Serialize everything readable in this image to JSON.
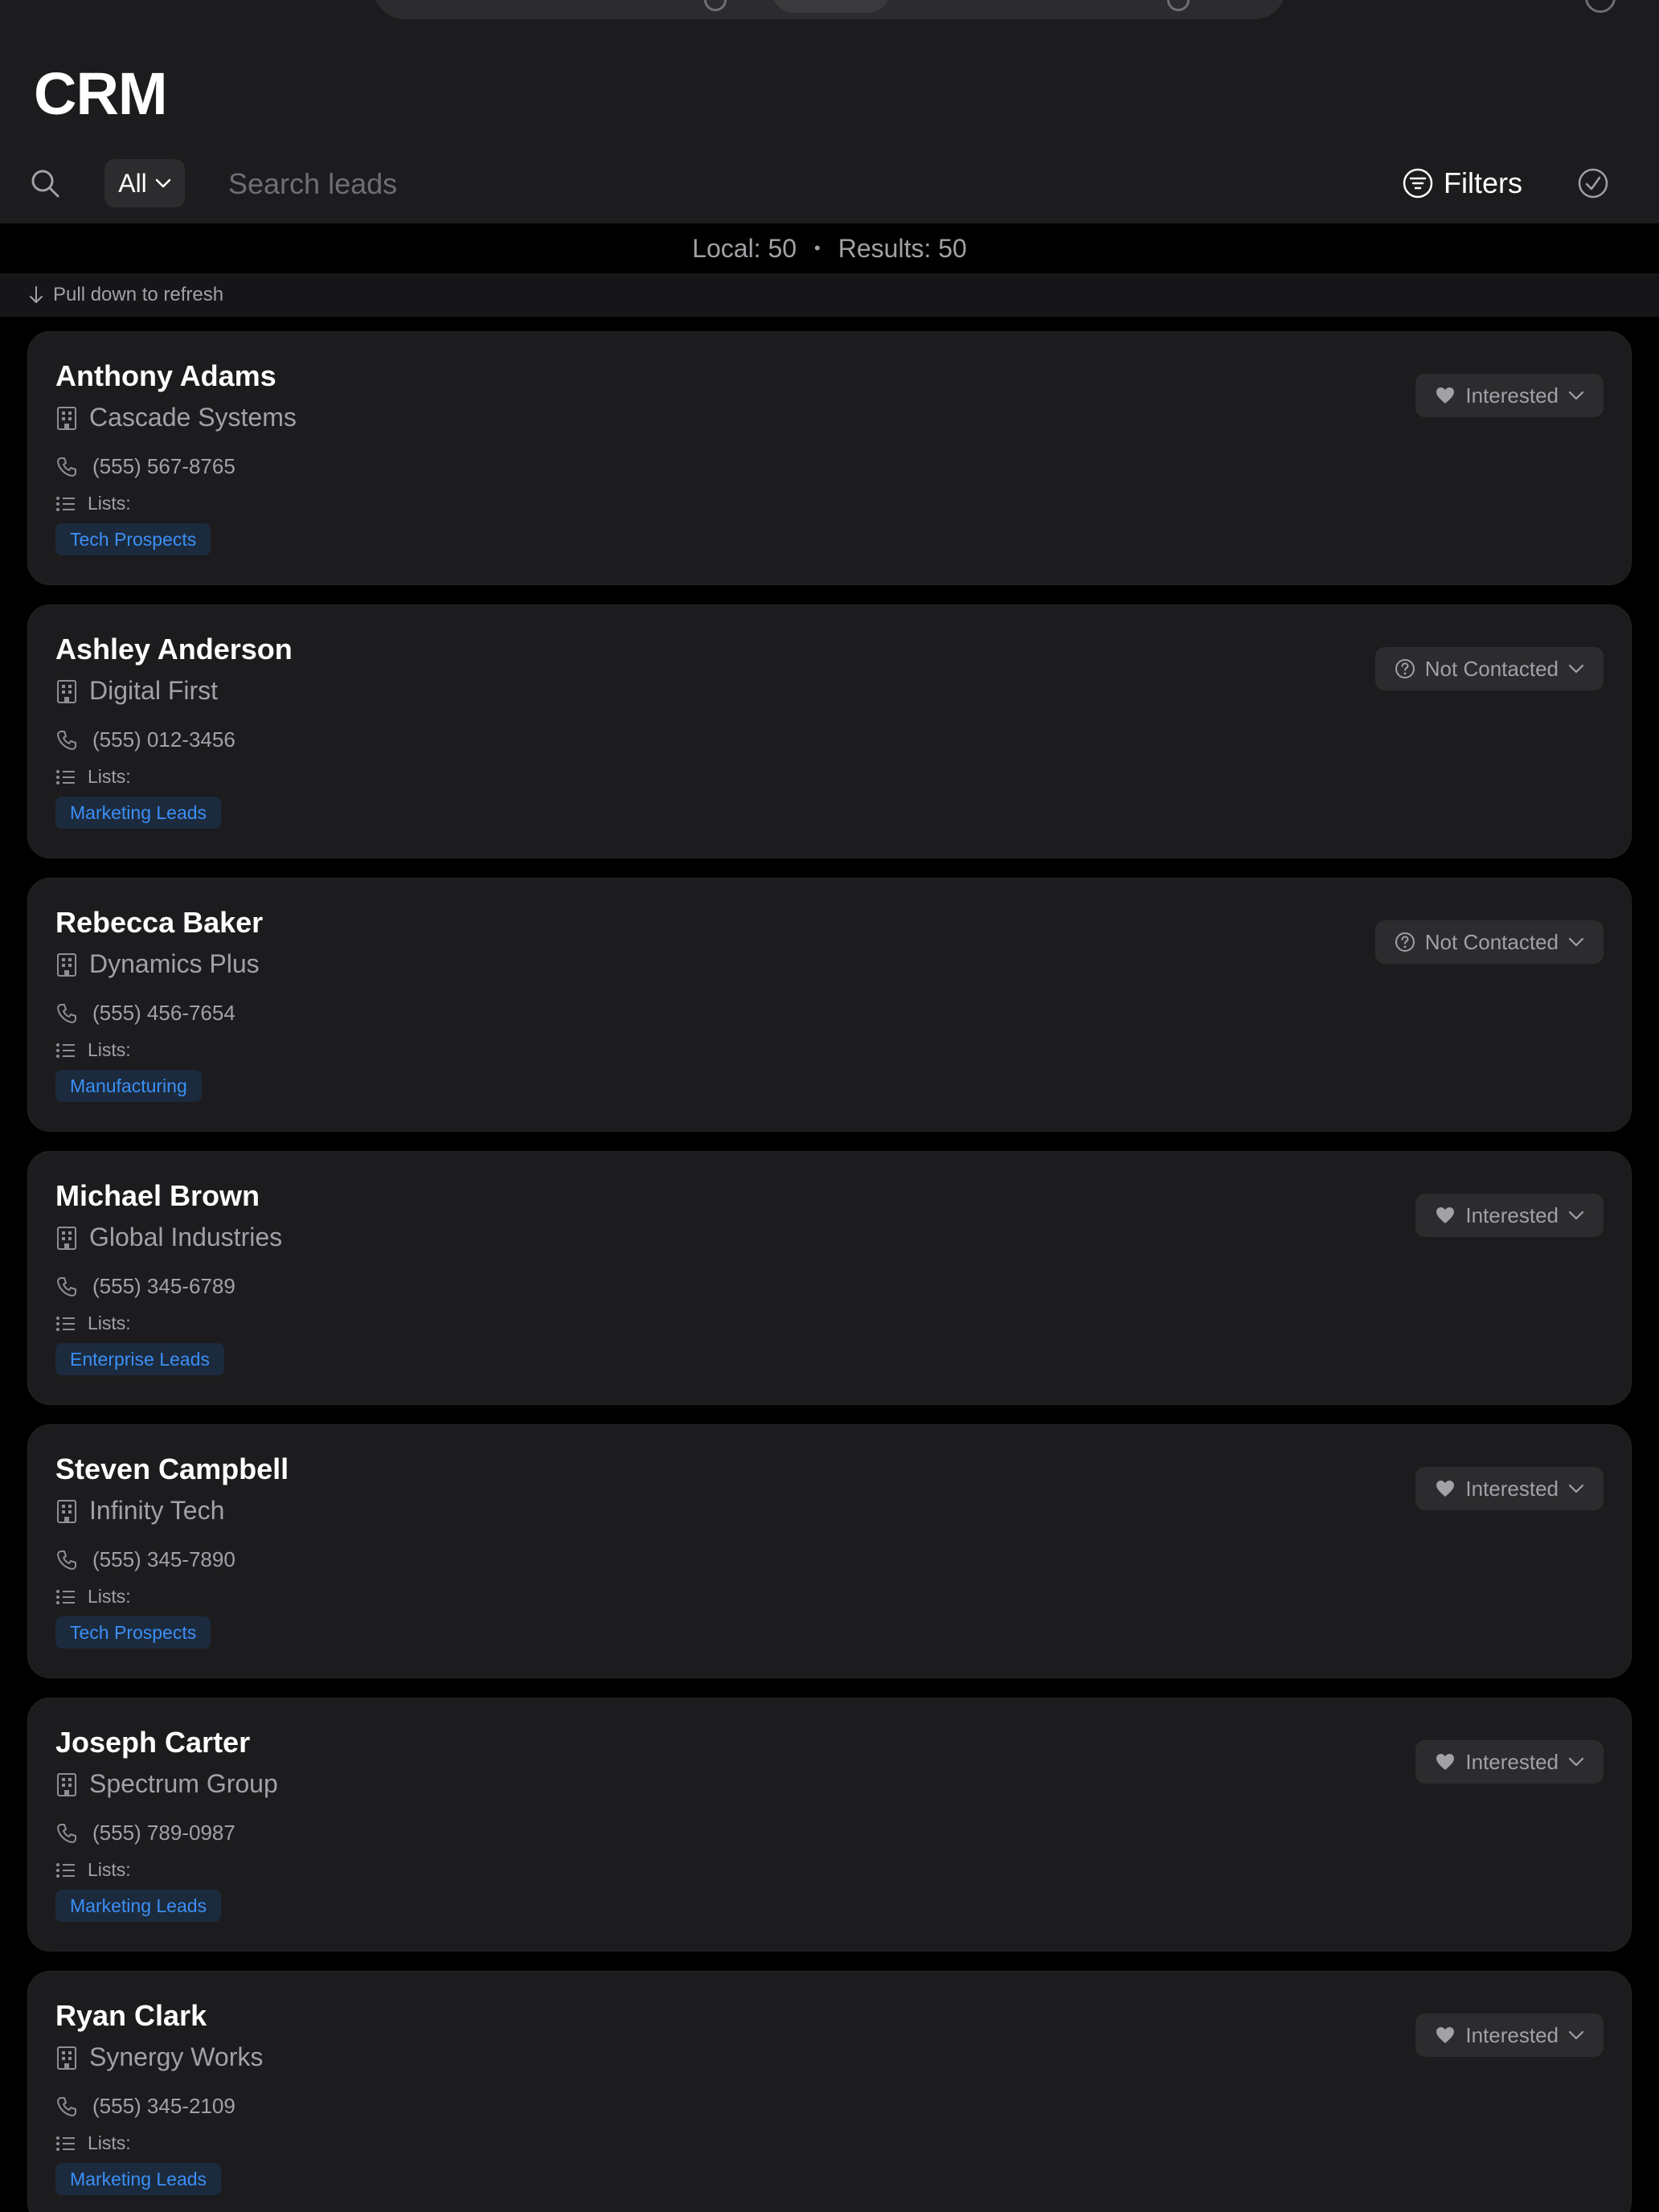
{
  "app": {
    "title": "CRM"
  },
  "search": {
    "scope": "All",
    "placeholder": "Search leads",
    "filters_label": "Filters"
  },
  "stats": {
    "local": "Local: 50",
    "separator": "•",
    "results": "Results: 50"
  },
  "refresh_hint": "Pull down to refresh",
  "lists_label": "Lists:",
  "leads": [
    {
      "name": "Anthony Adams",
      "company": "Cascade Systems",
      "phone": "(555) 567-8765",
      "list": "Tech Prospects",
      "status": "Interested",
      "status_icon": "heart-icon"
    },
    {
      "name": "Ashley Anderson",
      "company": "Digital First",
      "phone": "(555) 012-3456",
      "list": "Marketing Leads",
      "status": "Not Contacted",
      "status_icon": "question-circle-icon"
    },
    {
      "name": "Rebecca Baker",
      "company": "Dynamics Plus",
      "phone": "(555) 456-7654",
      "list": "Manufacturing",
      "status": "Not Contacted",
      "status_icon": "question-circle-icon"
    },
    {
      "name": "Michael Brown",
      "company": "Global Industries",
      "phone": "(555) 345-6789",
      "list": "Enterprise Leads",
      "status": "Interested",
      "status_icon": "heart-icon"
    },
    {
      "name": "Steven Campbell",
      "company": "Infinity Tech",
      "phone": "(555) 345-7890",
      "list": "Tech Prospects",
      "status": "Interested",
      "status_icon": "heart-icon"
    },
    {
      "name": "Joseph Carter",
      "company": "Spectrum Group",
      "phone": "(555) 789-0987",
      "list": "Marketing Leads",
      "status": "Interested",
      "status_icon": "heart-icon"
    },
    {
      "name": "Ryan Clark",
      "company": "Synergy Works",
      "phone": "(555) 345-2109",
      "list": "Marketing Leads",
      "status": "Interested",
      "status_icon": "heart-icon"
    }
  ],
  "colors": {
    "background": "#000000",
    "surface": "#1c1c1e",
    "control": "#2c2c2e",
    "text_primary": "#ffffff",
    "text_secondary": "#a1a1a6",
    "tag_text": "#3b8ff5",
    "tag_bg": "#1c2a3d"
  }
}
